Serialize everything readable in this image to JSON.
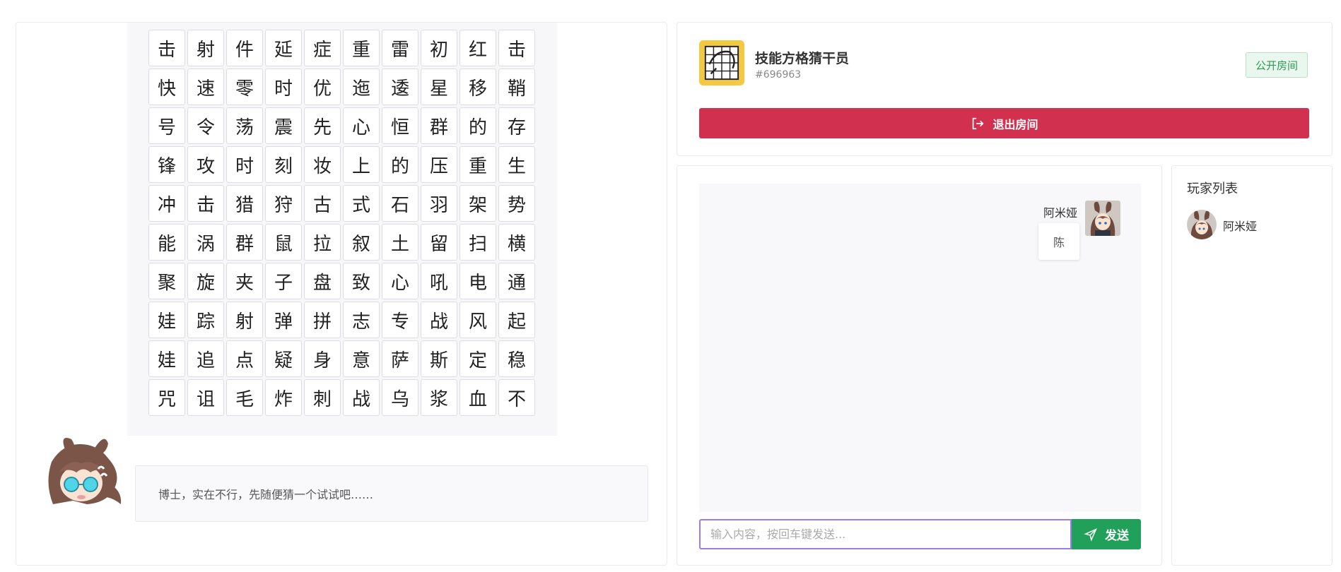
{
  "board": {
    "rows": [
      [
        "击",
        "射",
        "件",
        "延",
        "症",
        "重",
        "雷",
        "初",
        "红",
        "击"
      ],
      [
        "快",
        "速",
        "零",
        "时",
        "优",
        "迤",
        "逶",
        "星",
        "移",
        "鞘"
      ],
      [
        "号",
        "令",
        "荡",
        "震",
        "先",
        "心",
        "恒",
        "群",
        "的",
        "存"
      ],
      [
        "锋",
        "攻",
        "时",
        "刻",
        "妆",
        "上",
        "的",
        "压",
        "重",
        "生"
      ],
      [
        "冲",
        "击",
        "猎",
        "狩",
        "古",
        "式",
        "石",
        "羽",
        "架",
        "势"
      ],
      [
        "能",
        "涡",
        "群",
        "鼠",
        "拉",
        "叙",
        "土",
        "留",
        "扫",
        "横"
      ],
      [
        "聚",
        "旋",
        "夹",
        "子",
        "盘",
        "致",
        "心",
        "吼",
        "电",
        "通"
      ],
      [
        "娃",
        "踪",
        "射",
        "弹",
        "拼",
        "志",
        "专",
        "战",
        "风",
        "起"
      ],
      [
        "娃",
        "追",
        "点",
        "疑",
        "身",
        "意",
        "萨",
        "斯",
        "定",
        "稳"
      ],
      [
        "咒",
        "诅",
        "毛",
        "炸",
        "刺",
        "战",
        "乌",
        "浆",
        "血",
        "不"
      ]
    ],
    "hint": "博士，实在不行，先随便猜一个试试吧……"
  },
  "room": {
    "name": "技能方格猜干员",
    "id": "#696963",
    "badge": "公开房间",
    "exit_label": "退出房间"
  },
  "chat": {
    "messages": [
      {
        "user": "阿米娅",
        "text": "陈"
      }
    ],
    "input_placeholder": "输入内容，按回车键发送...",
    "input_value": "",
    "send_label": "发送"
  },
  "players": {
    "title": "玩家列表",
    "list": [
      {
        "name": "阿米娅"
      }
    ]
  },
  "colors": {
    "exit_button": "#d2304f",
    "send_button": "#21a05a",
    "badge_text": "#2e9a56",
    "logo_bg": "#f5c842",
    "input_focus": "#9b7dea"
  }
}
